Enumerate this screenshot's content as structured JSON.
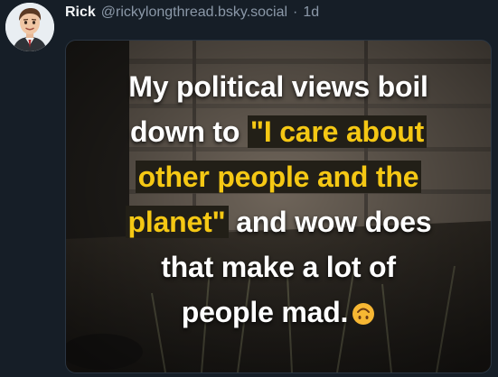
{
  "post": {
    "author": {
      "display_name": "Rick",
      "handle": "@rickylongthread.bsky.social",
      "separator": "·",
      "timestamp": "1d"
    },
    "image": {
      "caption_lines": [
        [
          {
            "text": "My political views boil",
            "highlight": false
          }
        ],
        [
          {
            "text": "down to ",
            "highlight": false
          },
          {
            "text": "\"I care about",
            "highlight": true
          }
        ],
        [
          {
            "text": "other people and the",
            "highlight": true
          }
        ],
        [
          {
            "text": "planet\"",
            "highlight": true
          },
          {
            "text": " and wow does",
            "highlight": false
          }
        ],
        [
          {
            "text": "that make a lot of",
            "highlight": false
          }
        ],
        [
          {
            "text": "people mad.",
            "highlight": false
          }
        ]
      ],
      "emoji": "upside-down-face",
      "highlight_color": "#f5c814",
      "text_color": "#ffffff"
    }
  }
}
